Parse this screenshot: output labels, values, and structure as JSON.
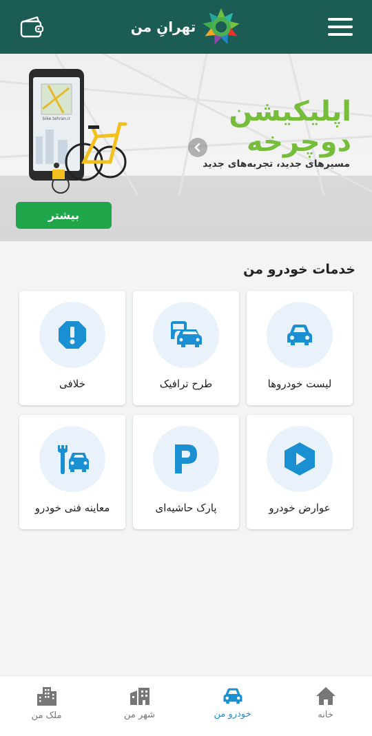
{
  "header": {
    "brand_name": "تهرانِ من",
    "colors": {
      "bar": "#1b5c55"
    }
  },
  "banner": {
    "title_line1": "اپلیکیشن",
    "title_line2": "دوچرخه",
    "subtitle": "مسیرهای جدید، تجربه‌های جدید",
    "phone_url": "bike.tehran.ir",
    "more_label": "بیشتر"
  },
  "section": {
    "title": "خدمات خودرو من"
  },
  "services": [
    {
      "label": "لیست خودروها",
      "icon": "car-icon"
    },
    {
      "label": "طرح ترافیک",
      "icon": "traffic-icon"
    },
    {
      "label": "خلافی",
      "icon": "violation-icon"
    },
    {
      "label": "عوارض خودرو",
      "icon": "toll-icon"
    },
    {
      "label": "پارک حاشیه‌ای",
      "icon": "parking-icon"
    },
    {
      "label": "معاینه فنی خودرو",
      "icon": "inspection-icon"
    }
  ],
  "bottom_nav": [
    {
      "label": "خانه",
      "icon": "home-icon",
      "active": false
    },
    {
      "label": "خودرو من",
      "icon": "car-icon",
      "active": true
    },
    {
      "label": "شهر من",
      "icon": "city-icon",
      "active": false
    },
    {
      "label": "ملک من",
      "icon": "building-icon",
      "active": false
    }
  ],
  "colors": {
    "accent_blue": "#1a8fd1",
    "green_button": "#1fa64a",
    "banner_title": "#76bd3c"
  }
}
